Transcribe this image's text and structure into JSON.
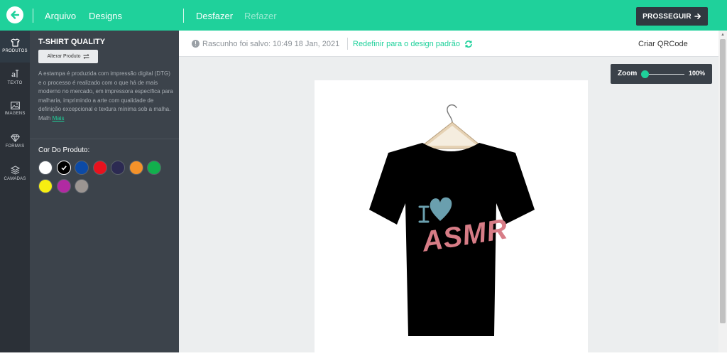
{
  "topbar": {
    "back_icon": "arrow-left-icon",
    "file_label": "Arquivo",
    "designs_label": "Designs",
    "undo_label": "Desfazer",
    "redo_label": "Refazer",
    "proceed_label": "PROSSEGUIR",
    "accent": "#1fd19b"
  },
  "rail": {
    "items": [
      {
        "label": "PRODUTOS",
        "icon": "tshirt-icon"
      },
      {
        "label": "TEXTO",
        "icon": "text-icon"
      },
      {
        "label": "IMAGENS",
        "icon": "image-icon"
      },
      {
        "label": "FORMAS",
        "icon": "diamond-icon"
      },
      {
        "label": "CAMADAS",
        "icon": "layers-icon"
      }
    ]
  },
  "panel": {
    "title": "T-SHIRT QUALITY",
    "change_button": "Alterar Produto",
    "description": "A estampa é produzida com impressão digital (DTG) e o processo é realizado com o que há de mais moderno no mercado, em impressora específica para malharia, imprimindo a arte com qualidade de definição excepcional e textura mínima sob a malha. Malh",
    "more_link": "Mais",
    "color_title": "Cor Do Produto:",
    "colors": [
      "#ffffff",
      "#000000",
      "#0c4aa6",
      "#e8121e",
      "#2c2a52",
      "#f4922a",
      "#12b04d",
      "#f6ee12",
      "#b12aa2",
      "#9b9592"
    ],
    "selected_color_index": 1
  },
  "status": {
    "saved_text": "Rascunho foi salvo: 10:49 18 Jan, 2021",
    "reset_label": "Redefinir para o design padrão",
    "qr_label": "Criar QRCode"
  },
  "zoom": {
    "label": "Zoom",
    "value": "100%",
    "level": 0.0
  },
  "design": {
    "i_letter": "I",
    "word": "ASMR",
    "shirt_color": "#000000",
    "heart_color": "#6a9fae",
    "word_color": "#d77c86"
  }
}
